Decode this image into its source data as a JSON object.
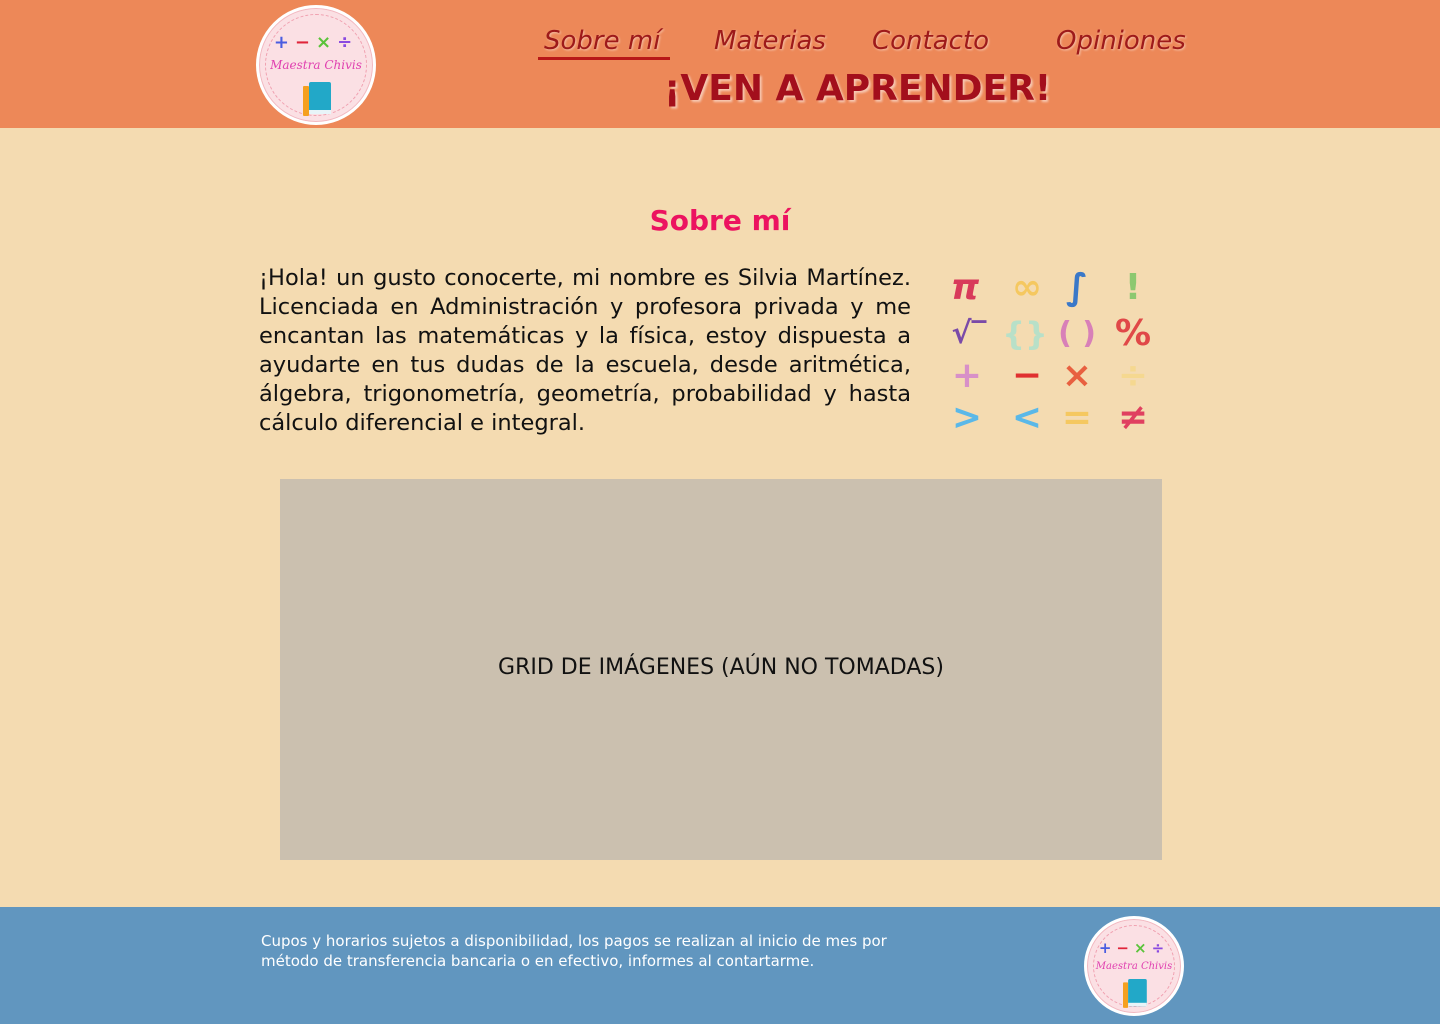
{
  "header": {
    "logo": {
      "ops": [
        "+",
        "−",
        "×",
        "÷"
      ],
      "name": "Maestra Chivis"
    },
    "nav": [
      {
        "label": "Sobre mí"
      },
      {
        "label": "Materias"
      },
      {
        "label": "Contacto"
      },
      {
        "label": "Opiniones"
      }
    ],
    "tagline": "¡VEN A APRENDER!"
  },
  "main": {
    "title": "Sobre mí",
    "intro": "¡Hola! un gusto conocerte, mi nombre es Silvia Martínez. Licenciada en Administración y profesora privada y me encantan las matemáticas y la física, estoy dispuesta a ayudarte en tus dudas de la escuela, desde aritmética, álgebra, trigonometría, geometría, probabilidad y hasta cálculo diferencial e integral.",
    "symbols": [
      "π",
      "∞",
      "∫",
      "!",
      "√‾",
      "{}",
      "( )",
      "%",
      "+",
      "−",
      "×",
      "÷",
      ">",
      "<",
      "=",
      "≠"
    ],
    "grid_placeholder": "GRID DE IMÁGENES (AÚN NO TOMADAS)"
  },
  "footer": {
    "text": "Cupos y horarios sujetos a disponibilidad, los pagos se realizan al inicio de mes por método de transferencia bancaria o en efectivo, informes al contartarme.",
    "logo": {
      "ops": [
        "+",
        "−",
        "×",
        "÷"
      ],
      "name": "Maestra Chivis"
    }
  },
  "colors": {
    "header_bg": "#ed8858",
    "page_bg": "#f4dbb1",
    "footer_bg": "#6196bf",
    "nav_text": "#9e1a1a",
    "title_pink": "#ec1360",
    "placeholder_bg": "#cbc0af"
  }
}
